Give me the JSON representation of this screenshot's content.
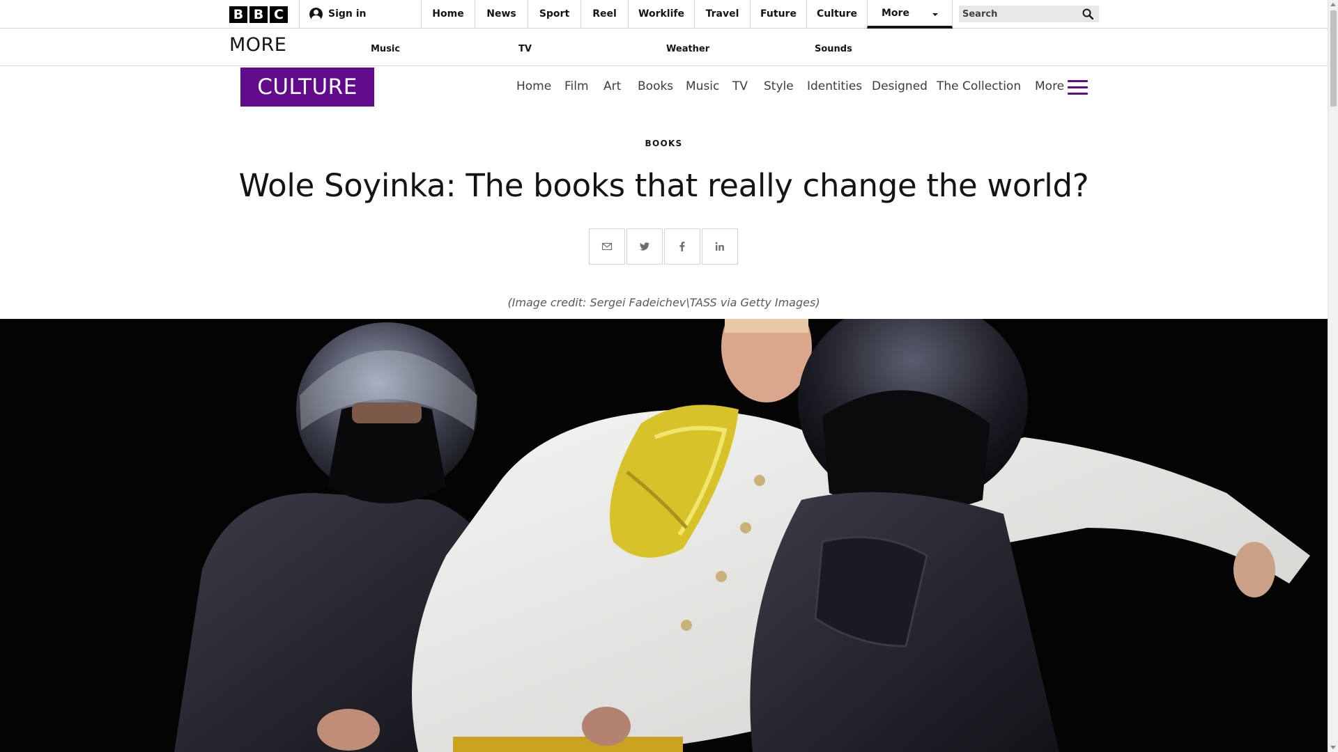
{
  "global_nav": {
    "logo_letters": [
      "B",
      "B",
      "C"
    ],
    "sign_in_label": "Sign in",
    "items": [
      {
        "label": "Home"
      },
      {
        "label": "News"
      },
      {
        "label": "Sport"
      },
      {
        "label": "Reel"
      },
      {
        "label": "Worklife"
      },
      {
        "label": "Travel"
      },
      {
        "label": "Future"
      },
      {
        "label": "Culture"
      }
    ],
    "more_label": "More",
    "search_placeholder": "Search"
  },
  "more_drawer": {
    "title": "MORE",
    "links": [
      {
        "label": "Music"
      },
      {
        "label": "TV"
      },
      {
        "label": "Weather"
      },
      {
        "label": "Sounds"
      }
    ]
  },
  "culture_header": {
    "logo_text": "CULTURE",
    "brand_color": "#5f0b8b",
    "nav": [
      {
        "label": "Home"
      },
      {
        "label": "Film"
      },
      {
        "label": "Art"
      },
      {
        "label": "Books"
      },
      {
        "label": "Music"
      },
      {
        "label": "TV"
      },
      {
        "label": "Style"
      },
      {
        "label": "Identities"
      },
      {
        "label": "Designed"
      },
      {
        "label": "The Collection"
      },
      {
        "label": "More"
      }
    ],
    "menu_icon": "hamburger-icon"
  },
  "article": {
    "section": "BOOKS",
    "headline": "Wole Soyinka: The books that really change the world?",
    "share_icons": [
      "email-icon",
      "twitter-icon",
      "facebook-icon",
      "linkedin-icon"
    ],
    "image_credit": "(Image credit: Sergei Fadeichev\\TASS via Getty Images)"
  }
}
